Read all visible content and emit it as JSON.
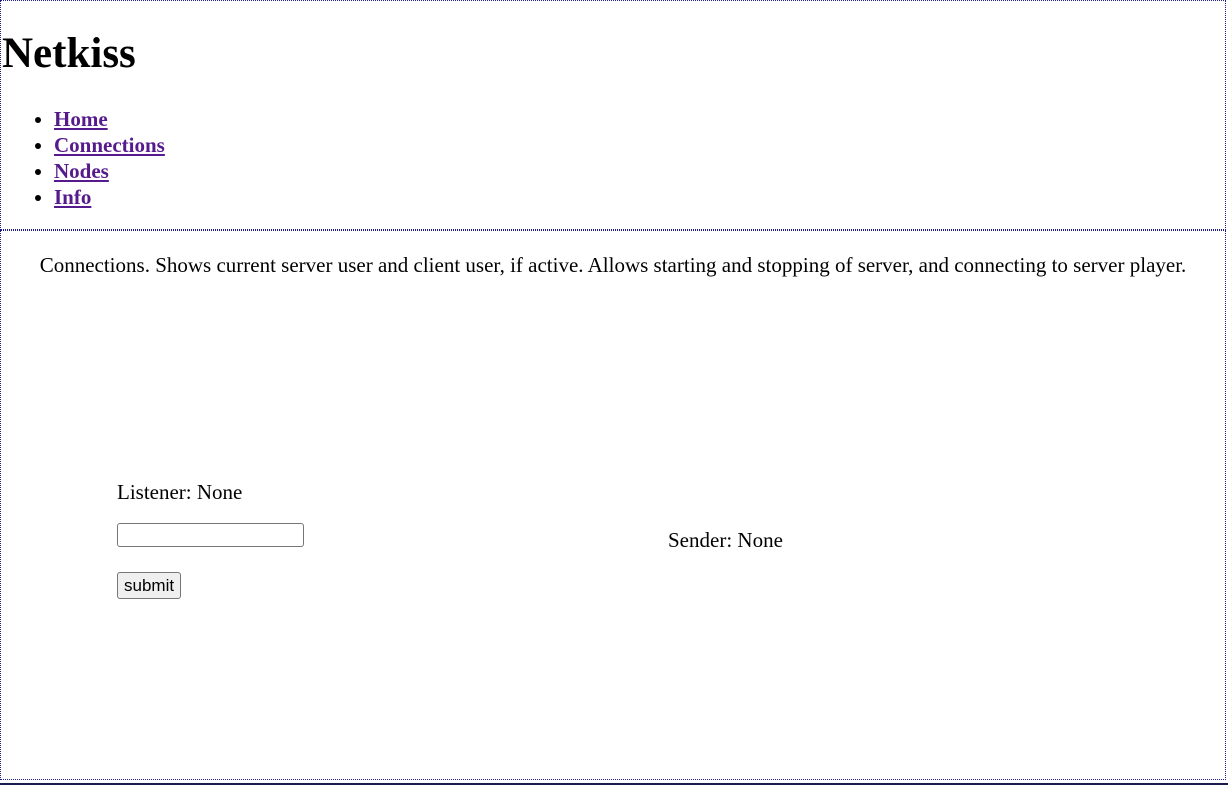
{
  "header": {
    "title": "Netkiss",
    "nav": [
      {
        "label": "Home"
      },
      {
        "label": "Connections"
      },
      {
        "label": "Nodes"
      },
      {
        "label": "Info"
      }
    ]
  },
  "main": {
    "description": "Connections. Shows current server user and client user, if active. Allows starting and stopping of server, and connecting to server player.",
    "listener": {
      "label": "Listener: None",
      "input_value": "",
      "submit_label": "submit"
    },
    "sender": {
      "label": "Sender: None"
    }
  },
  "colors": {
    "link": "#551a8b",
    "border": "#1a1a8c"
  }
}
